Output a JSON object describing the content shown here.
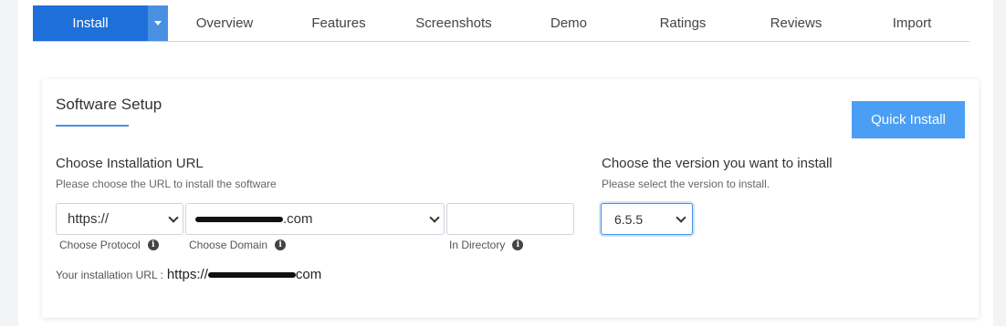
{
  "tabs": {
    "install": "Install",
    "items": [
      "Overview",
      "Features",
      "Screenshots",
      "Demo",
      "Ratings",
      "Reviews",
      "Import"
    ]
  },
  "setup": {
    "title": "Software Setup",
    "quick_install": "Quick Install",
    "url_section": {
      "label": "Choose Installation URL",
      "hint": "Please choose the URL to install the software",
      "protocol_value": "https://",
      "protocol_label": "Choose Protocol",
      "domain_suffix": ".com",
      "domain_label": "Choose Domain",
      "directory_value": "",
      "directory_label": "In Directory"
    },
    "version_section": {
      "label": "Choose the version you want to install",
      "hint": "Please select the version to install.",
      "selected": "6.5.5"
    },
    "installation_url": {
      "label": "Your installation URL :",
      "prefix": "https://",
      "suffix": "com"
    }
  },
  "colors": {
    "primary": "#1e6fd9",
    "accent": "#4a9ff5"
  }
}
